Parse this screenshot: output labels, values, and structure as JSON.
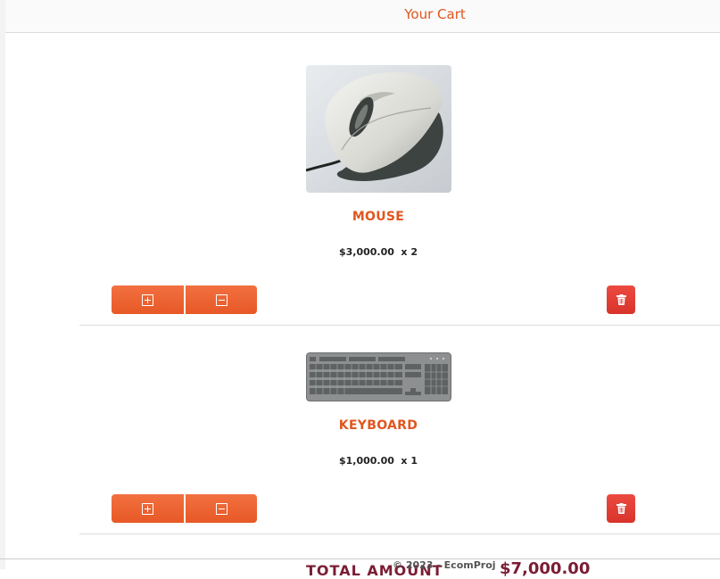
{
  "header": {
    "title": "Your Cart"
  },
  "cart": {
    "items": [
      {
        "name": "MOUSE",
        "price": "$3,000.00",
        "quantity": "x 2",
        "image": "computer-mouse-image"
      },
      {
        "name": "KEYBOARD",
        "price": "$1,000.00",
        "quantity": "x 1",
        "image": "keyboard-image"
      }
    ],
    "actions": {
      "increase_icon": "plus-square-icon",
      "decrease_icon": "minus-square-icon",
      "delete_icon": "trash-icon"
    }
  },
  "summary": {
    "total_label": "TOTAL AMOUNT",
    "total_value": "$7,000.00"
  },
  "footer": {
    "copyright": "© 2023 - EcomProj"
  },
  "colors": {
    "accent": "#e0561f",
    "button": "#ec6333",
    "delete": "#e2403a",
    "total": "#7a1d34"
  }
}
